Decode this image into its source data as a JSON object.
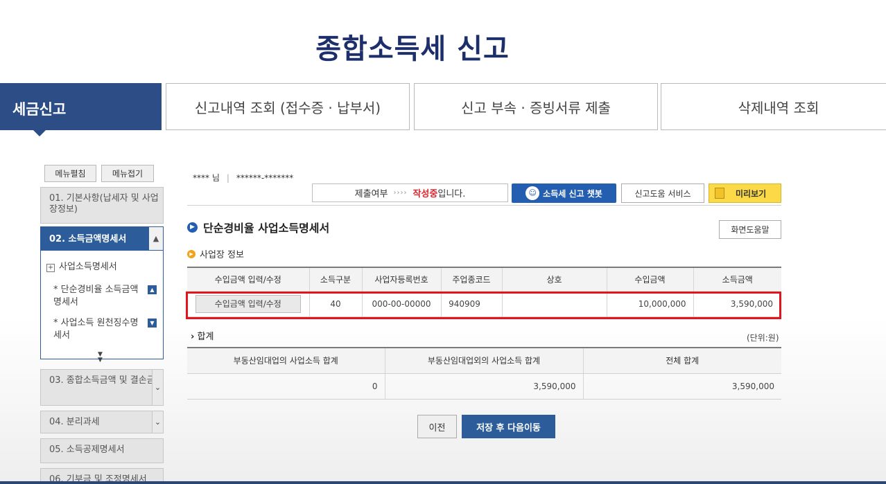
{
  "page_title": "종합소득세 신고",
  "tabs": [
    {
      "label": "세금신고"
    },
    {
      "label": "신고내역 조회 (접수증 · 납부서)"
    },
    {
      "label": "신고 부속 · 증빙서류 제출"
    },
    {
      "label": "삭제내역 조회"
    }
  ],
  "sidebar": {
    "expand_label": "메뉴펼침",
    "collapse_label": "메뉴접기",
    "items": [
      {
        "label": "01. 기본사항(납세자 및 사업장정보)"
      },
      {
        "label": "02. 소득금액명세서"
      },
      {
        "label": "03. 종합소득금액 및 결손금"
      },
      {
        "label": "04. 분리과세"
      },
      {
        "label": "05. 소득공제명세서"
      },
      {
        "label": "06. 기부금 및 조정명세서"
      }
    ],
    "sub_header": "사업소득명세서",
    "sub_items": [
      {
        "label": "단순경비율 소득금액명세서"
      },
      {
        "label": "사업소득 원천징수명세서"
      }
    ]
  },
  "user": {
    "name": "**** 님",
    "id": "******-*******"
  },
  "status": {
    "prefix": "제출여부",
    "arrows": "››››",
    "state": "작성중",
    "suffix": "입니다."
  },
  "toolbar": {
    "chatbot_label": "소득세 신고 챗봇",
    "help_service_label": "신고도움 서비스",
    "preview_label": "미리보기"
  },
  "section": {
    "title": "단순경비율 사업소득명세서",
    "screen_help_label": "화면도움말"
  },
  "business_info": {
    "title": "사업장 정보",
    "columns": [
      "수입금액 입력/수정",
      "소득구분",
      "사업자등록번호",
      "주업종코드",
      "상호",
      "수입금액",
      "소득금액"
    ],
    "row": {
      "button_label": "수입금액 입력/수정",
      "income_type": "40",
      "biz_reg_no": "000-00-00000",
      "industry_code": "940909",
      "trade_name": "",
      "revenue": "10,000,000",
      "income": "3,590,000"
    }
  },
  "totals": {
    "title": "합계",
    "unit": "(단위:원)",
    "columns": [
      "부동산임대업의 사업소득 합계",
      "부동산임대업외의 사업소득 합계",
      "전체 합계"
    ],
    "values": [
      "0",
      "3,590,000",
      "3,590,000"
    ]
  },
  "actions": {
    "prev_label": "이전",
    "next_label": "저장 후 다음이동"
  },
  "colors": {
    "primary": "#2c4d86",
    "accent": "#245eb0",
    "highlight": "#e1151b",
    "preview": "#fbd947"
  }
}
